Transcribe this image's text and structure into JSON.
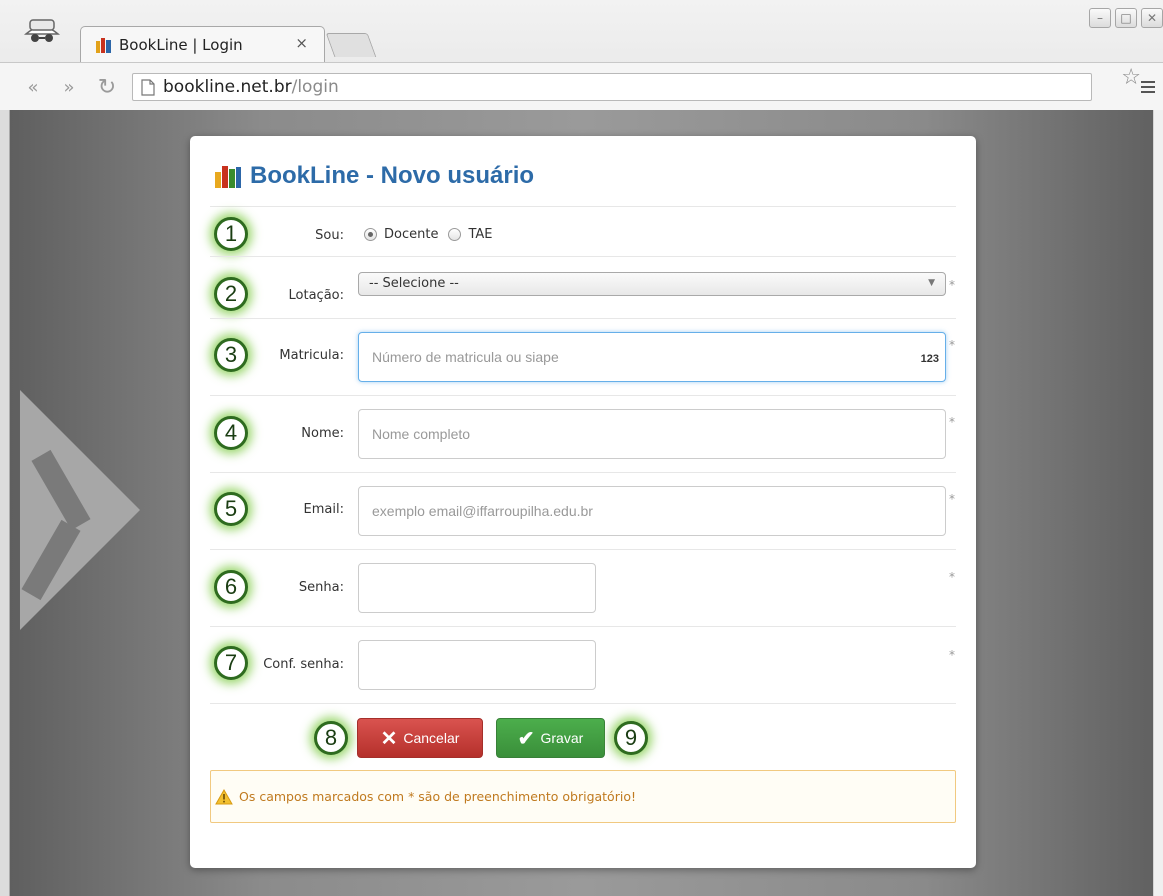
{
  "browser": {
    "tab_title": "BookLine | Login",
    "tab_close": "×",
    "url_host": "bookline.net.br",
    "url_path": "/login"
  },
  "form": {
    "title": "BookLine - Novo usuário",
    "sou": {
      "label": "Sou:",
      "options": [
        "Docente",
        "TAE"
      ],
      "selected": "Docente"
    },
    "lotacao": {
      "label": "Lotação:",
      "value": "-- Selecione --"
    },
    "matricula": {
      "label": "Matricula:",
      "placeholder": "Número de matricula ou siape",
      "hint": "123"
    },
    "nome": {
      "label": "Nome:",
      "placeholder": "Nome completo"
    },
    "email": {
      "label": "Email:",
      "placeholder": "exemplo email@iffarroupilha.edu.br"
    },
    "senha": {
      "label": "Senha:"
    },
    "conf_senha": {
      "label": "Conf. senha:"
    },
    "required_mark": "*",
    "buttons": {
      "cancel": "Cancelar",
      "save": "Gravar"
    },
    "alert": "Os campos marcados com * são de preenchimento obrigatório!"
  },
  "annotations": [
    "1",
    "2",
    "3",
    "4",
    "5",
    "6",
    "7",
    "8",
    "9"
  ],
  "colors": {
    "title": "#2d6ba8",
    "cancel": "#d9534f",
    "save": "#4cae4c",
    "alert_text": "#c07a1f",
    "badge_glow": "#78c83c"
  }
}
